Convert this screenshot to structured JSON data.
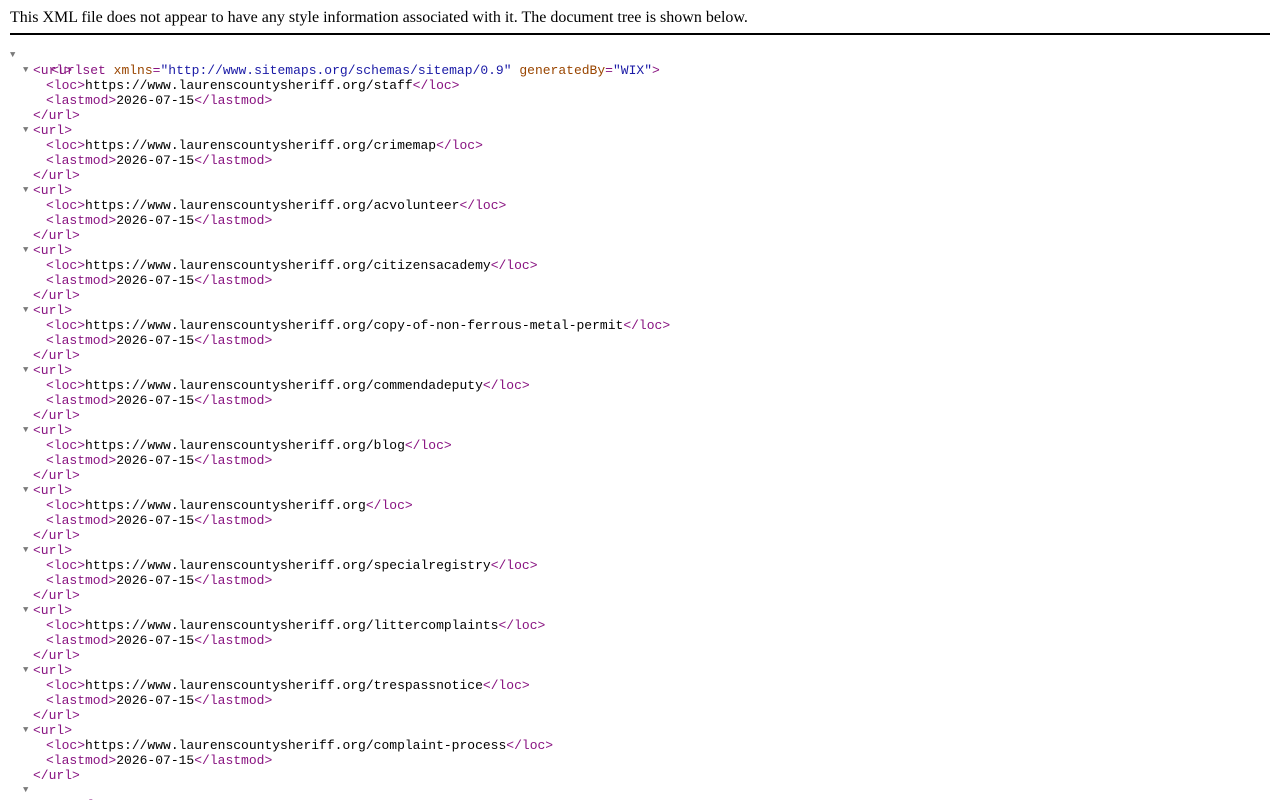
{
  "header": {
    "message": "This XML file does not appear to have any style information associated with it. The document tree is shown below."
  },
  "icons": {
    "toggle": "▼"
  },
  "root": {
    "open_prefix": "<urlset",
    "attr1_name": "xmlns",
    "attr1_value": "\"http://www.sitemaps.org/schemas/sitemap/0.9\"",
    "attr2_name": "generatedBy",
    "attr2_value": "\"WIX\"",
    "open_suffix": ">"
  },
  "tags": {
    "url_open": "<url>",
    "url_close": "</url>",
    "loc_open": "<loc>",
    "loc_close": "</loc>",
    "lastmod_open": "<lastmod>",
    "lastmod_close": "</lastmod>"
  },
  "urls": [
    {
      "loc": "https://www.laurenscountysheriff.org/staff",
      "lastmod": "2026-07-15"
    },
    {
      "loc": "https://www.laurenscountysheriff.org/crimemap",
      "lastmod": "2026-07-15"
    },
    {
      "loc": "https://www.laurenscountysheriff.org/acvolunteer",
      "lastmod": "2026-07-15"
    },
    {
      "loc": "https://www.laurenscountysheriff.org/citizensacademy",
      "lastmod": "2026-07-15"
    },
    {
      "loc": "https://www.laurenscountysheriff.org/copy-of-non-ferrous-metal-permit",
      "lastmod": "2026-07-15"
    },
    {
      "loc": "https://www.laurenscountysheriff.org/commendadeputy",
      "lastmod": "2026-07-15"
    },
    {
      "loc": "https://www.laurenscountysheriff.org/blog",
      "lastmod": "2026-07-15"
    },
    {
      "loc": "https://www.laurenscountysheriff.org",
      "lastmod": "2026-07-15"
    },
    {
      "loc": "https://www.laurenscountysheriff.org/specialregistry",
      "lastmod": "2026-07-15"
    },
    {
      "loc": "https://www.laurenscountysheriff.org/littercomplaints",
      "lastmod": "2026-07-15"
    },
    {
      "loc": "https://www.laurenscountysheriff.org/trespassnotice",
      "lastmod": "2026-07-15"
    },
    {
      "loc": "https://www.laurenscountysheriff.org/complaint-process",
      "lastmod": "2026-07-15"
    }
  ]
}
